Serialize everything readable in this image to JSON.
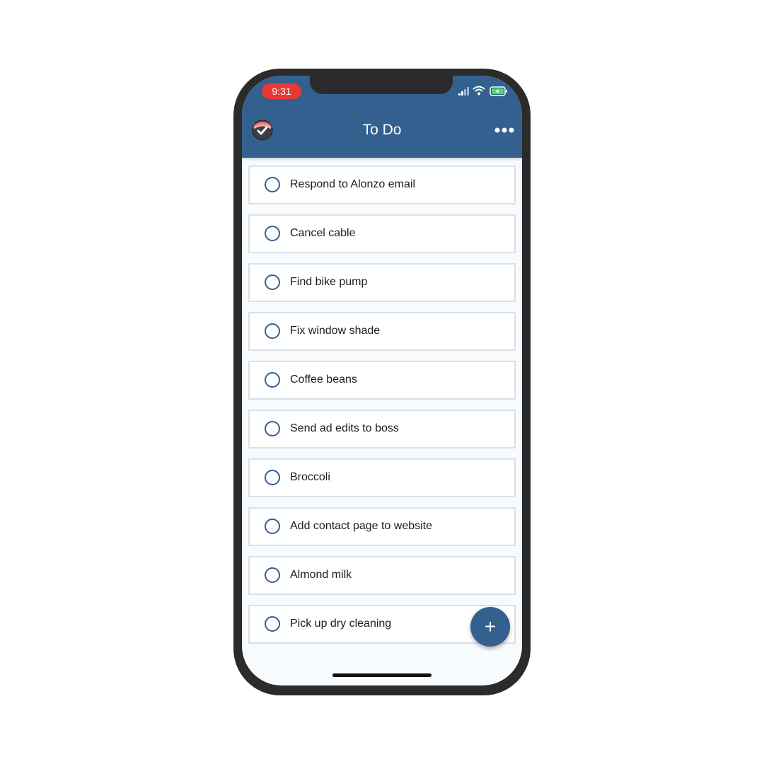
{
  "status_bar": {
    "time": "9:31",
    "signal_icon": "cellular-signal-icon",
    "wifi_icon": "wifi-icon",
    "battery_icon": "battery-charging-icon"
  },
  "header": {
    "title": "To Do",
    "logo_icon": "app-logo-icon",
    "more_icon": "more-horizontal-icon"
  },
  "todos": [
    {
      "label": "Respond to Alonzo email",
      "done": false
    },
    {
      "label": "Cancel cable",
      "done": false
    },
    {
      "label": "Find bike pump",
      "done": false
    },
    {
      "label": "Fix window shade",
      "done": false
    },
    {
      "label": "Coffee beans",
      "done": false
    },
    {
      "label": "Send ad edits to boss",
      "done": false
    },
    {
      "label": "Broccoli",
      "done": false
    },
    {
      "label": "Add contact page to website",
      "done": false
    },
    {
      "label": "Almond milk",
      "done": false
    },
    {
      "label": "Pick up dry cleaning",
      "done": false
    }
  ],
  "fab": {
    "label": "+",
    "icon": "plus-icon"
  },
  "colors": {
    "accent": "#34608f",
    "time_pill": "#e53935",
    "background": "#f7fbfd"
  }
}
